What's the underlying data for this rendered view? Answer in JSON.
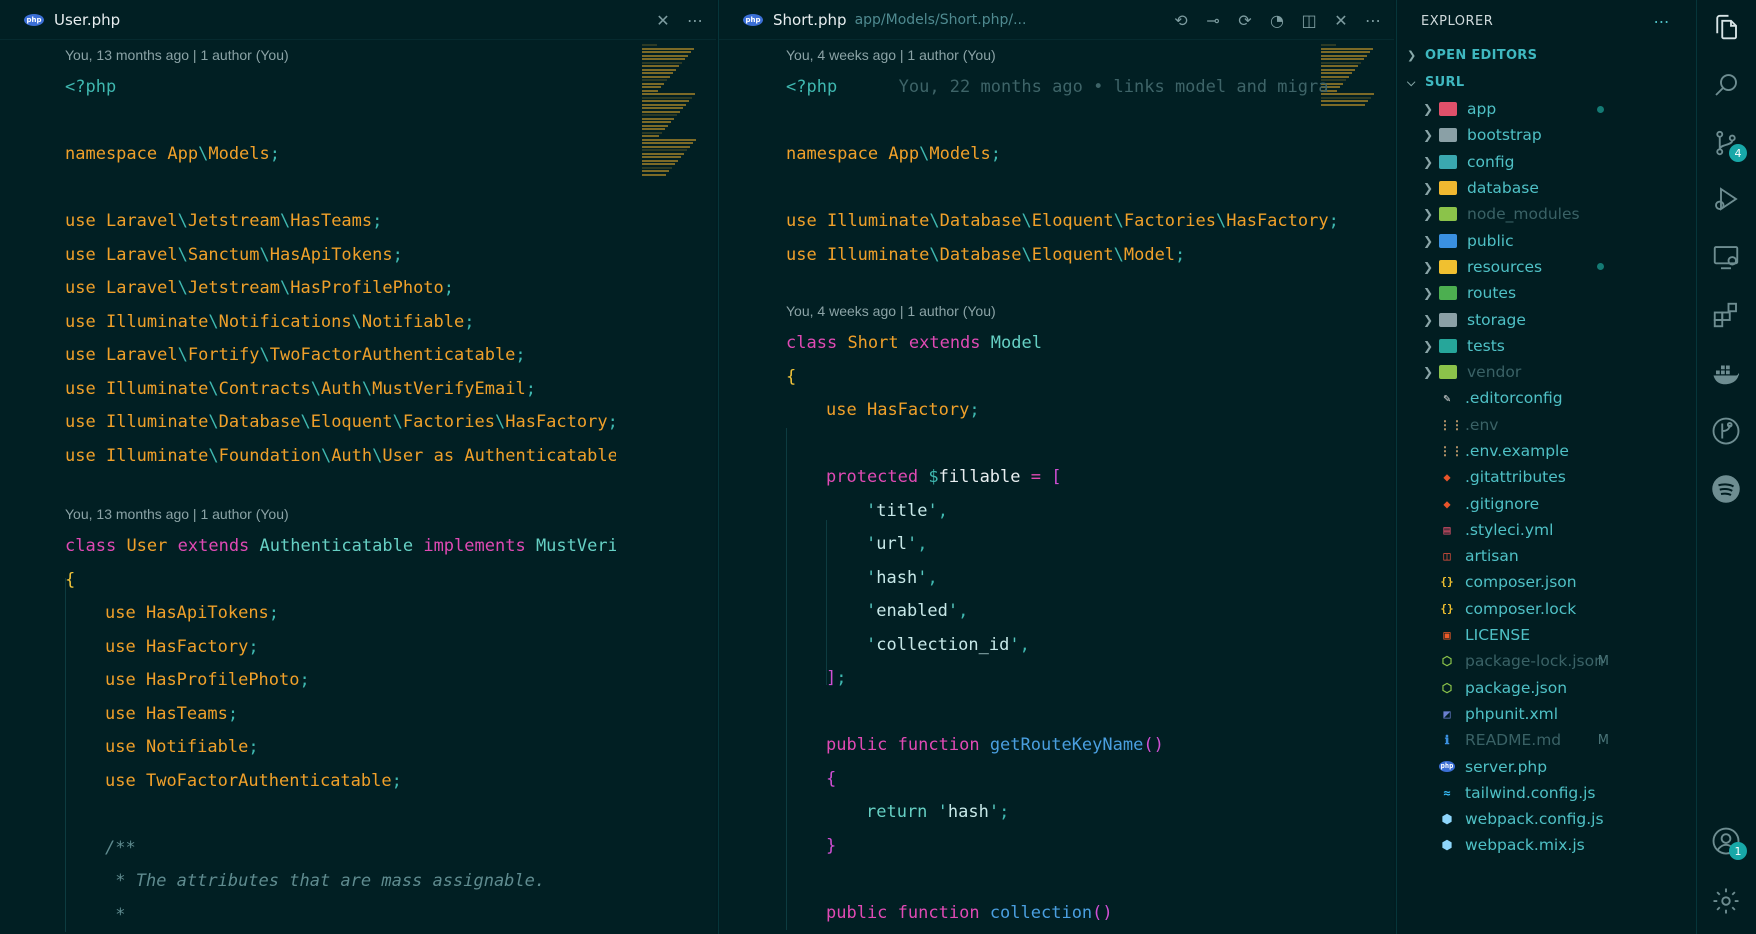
{
  "left_editor": {
    "tab_title": "User.php",
    "blame_top": "You, 13 months ago | 1 author (You)",
    "blame_class": "You, 13 months ago | 1 author (You)",
    "lines": {
      "open": "<?php",
      "ns_kw": "namespace",
      "ns_a": "App",
      "ns_b": "Models",
      "use": "use",
      "u1": [
        "Laravel",
        "Jetstream",
        "HasTeams"
      ],
      "u2": [
        "Laravel",
        "Sanctum",
        "HasApiTokens"
      ],
      "u3": [
        "Laravel",
        "Jetstream",
        "HasProfilePhoto"
      ],
      "u4": [
        "Illuminate",
        "Notifications",
        "Notifiable"
      ],
      "u5": [
        "Laravel",
        "Fortify",
        "TwoFactorAuthenticatable"
      ],
      "u6": [
        "Illuminate",
        "Contracts",
        "Auth",
        "MustVerifyEmail"
      ],
      "u7": [
        "Illuminate",
        "Database",
        "Eloquent",
        "Factories",
        "HasFactory"
      ],
      "u8": [
        "Illuminate",
        "Foundation",
        "Auth",
        "User",
        "as",
        "Authenticatable"
      ],
      "class_kw": "class",
      "class_name": "User",
      "extends": "extends",
      "parent": "Authenticatable",
      "implements": "implements",
      "iface": "MustVerifyE",
      "traits": [
        "HasApiTokens",
        "HasFactory",
        "HasProfilePhoto",
        "HasTeams",
        "Notifiable",
        "TwoFactorAuthenticatable"
      ],
      "doc1": "/**",
      "doc2": "* The attributes that are mass assignable.",
      "doc3": "*"
    }
  },
  "right_editor": {
    "tab_title": "Short.php",
    "tab_path": "app/Models/Short.php/...",
    "blame_top": "You, 4 weeks ago | 1 author (You)",
    "blame_class": "You, 4 weeks ago | 1 author (You)",
    "inline_blame": "You, 22 months ago • links model and migra",
    "lines": {
      "open": "<?php",
      "ns_kw": "namespace",
      "ns_a": "App",
      "ns_b": "Models",
      "use": "use",
      "u1": [
        "Illuminate",
        "Database",
        "Eloquent",
        "Factories",
        "HasFactory"
      ],
      "u2": [
        "Illuminate",
        "Database",
        "Eloquent",
        "Model"
      ],
      "class_kw": "class",
      "class_name": "Short",
      "extends": "extends",
      "parent": "Model",
      "trait": "HasFactory",
      "protected": "protected",
      "fillable": "fillable",
      "fillable_items": [
        "title",
        "url",
        "hash",
        "enabled",
        "collection_id"
      ],
      "public": "public",
      "function": "function",
      "fn1": "getRouteKeyName",
      "return": "return",
      "ret_val": "hash",
      "fn2": "collection"
    }
  },
  "explorer": {
    "title": "EXPLORER",
    "open_editors": "OPEN EDITORS",
    "project": "SURL",
    "folders": [
      {
        "name": "app",
        "color": "#e0506a",
        "dot": true
      },
      {
        "name": "bootstrap",
        "color": "#8aa0a6"
      },
      {
        "name": "config",
        "color": "#3aa8b0"
      },
      {
        "name": "database",
        "color": "#f0b830"
      },
      {
        "name": "node_modules",
        "color": "#8bc34a",
        "dim": true
      },
      {
        "name": "public",
        "color": "#3a90e0"
      },
      {
        "name": "resources",
        "color": "#f0c030",
        "dot": true
      },
      {
        "name": "routes",
        "color": "#4caf50"
      },
      {
        "name": "storage",
        "color": "#8aa0a6"
      },
      {
        "name": "tests",
        "color": "#26a69a"
      },
      {
        "name": "vendor",
        "color": "#8bc34a",
        "dim": true
      }
    ],
    "files": [
      {
        "name": ".editorconfig",
        "glyph": "✎",
        "color": "#e0e0e0"
      },
      {
        "name": ".env",
        "glyph": "⋮⋮",
        "color": "#c8a070",
        "dim": true
      },
      {
        "name": ".env.example",
        "glyph": "⋮⋮",
        "color": "#c8a070"
      },
      {
        "name": ".gitattributes",
        "glyph": "◆",
        "color": "#e8542a"
      },
      {
        "name": ".gitignore",
        "glyph": "◆",
        "color": "#e8542a"
      },
      {
        "name": ".styleci.yml",
        "glyph": "▤",
        "color": "#e0506a"
      },
      {
        "name": "artisan",
        "glyph": "◫",
        "color": "#f0533f"
      },
      {
        "name": "composer.json",
        "glyph": "{}",
        "color": "#f0c030"
      },
      {
        "name": "composer.lock",
        "glyph": "{}",
        "color": "#f0c030"
      },
      {
        "name": "LICENSE",
        "glyph": "▣",
        "color": "#f05a28"
      },
      {
        "name": "package-lock.json",
        "glyph": "⬡",
        "color": "#8bc34a",
        "dim": true,
        "mark": "M"
      },
      {
        "name": "package.json",
        "glyph": "⬡",
        "color": "#8bc34a"
      },
      {
        "name": "phpunit.xml",
        "glyph": "◩",
        "color": "#6a7fd0"
      },
      {
        "name": "README.md",
        "glyph": "ℹ",
        "color": "#3a90e0",
        "dim": true,
        "mark": "M"
      },
      {
        "name": "server.php",
        "glyph": "php",
        "color": "#3b6fd6"
      },
      {
        "name": "tailwind.config.js",
        "glyph": "≈",
        "color": "#38bdf8"
      },
      {
        "name": "webpack.config.js",
        "glyph": "⬢",
        "color": "#8ed6fb"
      },
      {
        "name": "webpack.mix.js",
        "glyph": "⬢",
        "color": "#8ed6fb"
      }
    ]
  },
  "activity_bar": {
    "scm_badge": "4",
    "account_badge": "1"
  }
}
